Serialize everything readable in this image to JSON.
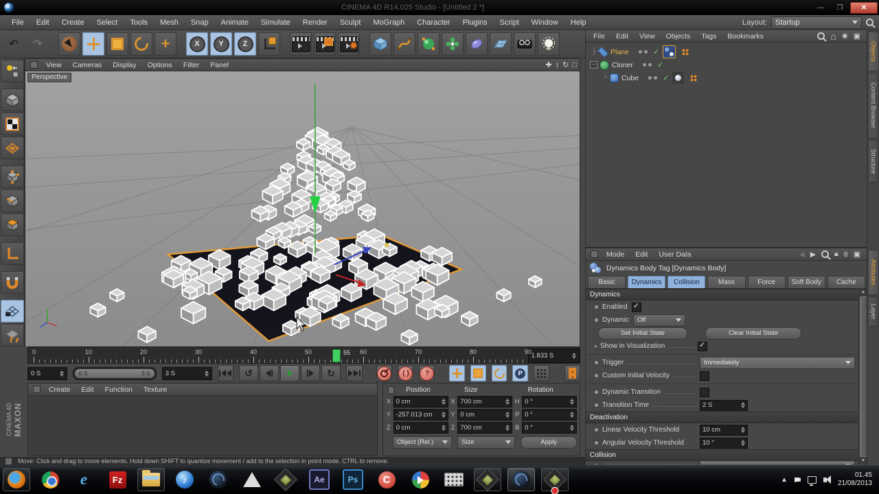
{
  "window": {
    "title": "CINEMA 4D R14.025 Studio - [Untitled 2 *]"
  },
  "menubar": {
    "items": [
      "File",
      "Edit",
      "Create",
      "Select",
      "Tools",
      "Mesh",
      "Snap",
      "Animate",
      "Simulate",
      "Render",
      "Sculpt",
      "MoGraph",
      "Character",
      "Plugins",
      "Script",
      "Window",
      "Help"
    ],
    "layout_label": "Layout:",
    "layout_value": "Startup"
  },
  "viewport": {
    "menu": [
      "View",
      "Cameras",
      "Display",
      "Options",
      "Filter",
      "Panel"
    ],
    "camera_label": "Perspective"
  },
  "object_manager": {
    "menu": [
      "File",
      "Edit",
      "View",
      "Objects",
      "Tags",
      "Bookmarks"
    ],
    "objects": [
      {
        "name": "Plane"
      },
      {
        "name": "Cloner"
      },
      {
        "name": "Cube"
      }
    ]
  },
  "side_tabs": {
    "top": [
      "Objects",
      "Content Browser",
      "Structure"
    ],
    "bottom": [
      "Attributes",
      "Layer"
    ]
  },
  "attributes": {
    "menu": [
      "Mode",
      "Edit",
      "User Data"
    ],
    "title": "Dynamics Body Tag [Dynamics Body]",
    "tabs": [
      "Basic",
      "Dynamics",
      "Collision",
      "Mass",
      "Force",
      "Soft Body",
      "Cache"
    ],
    "active_tabs": [
      "Dynamics",
      "Collision"
    ],
    "sections": {
      "dynamics": "Dynamics",
      "deactivation": "Deactivation",
      "collision": "Collision"
    },
    "labels": {
      "enabled": "Enabled",
      "dynamic": "Dynamic",
      "set_initial": "Set Initial State",
      "clear_initial": "Clear Initial State",
      "show_vis": "Show in Visualization",
      "trigger": "Trigger",
      "custom_velocity": "Custom Initial Velocity",
      "dynamic_transition": "Dynamic Transition",
      "transition_time": "Transition Time",
      "linear_threshold": "Linear Velocity Threshold",
      "angular_threshold": "Angular Velocity Threshold"
    },
    "values": {
      "dynamic": "Off",
      "trigger": "Immediately",
      "transition_time": "2 S",
      "linear_threshold": "10 cm",
      "angular_threshold": "10 °"
    }
  },
  "timeline": {
    "tick_labels": [
      "0",
      "10",
      "20",
      "30",
      "40",
      "50",
      "60",
      "70",
      "80",
      "90"
    ],
    "playhead_frame": "55",
    "current_time": "1.833 S",
    "start_time": "0 S",
    "end_time": "3 S",
    "range_min": "0 S",
    "range_max": "3 S"
  },
  "materials": {
    "menu": [
      "Create",
      "Edit",
      "Function",
      "Texture"
    ]
  },
  "coordinates": {
    "headers": [
      "Position",
      "Size",
      "Rotation"
    ],
    "position": {
      "x_label": "X",
      "x": "0 cm",
      "y_label": "Y",
      "y": "-257.013 cm",
      "z_label": "Z",
      "z": "0 cm"
    },
    "size": {
      "x_label": "X",
      "x": "700 cm",
      "y_label": "Y",
      "y": "0 cm",
      "z_label": "Z",
      "z": "700 cm"
    },
    "rotation": {
      "h_label": "H",
      "h": "0 °",
      "p_label": "P",
      "p": "0 °",
      "b_label": "B",
      "b": "0 °"
    },
    "mode_object": "Object (Rel.)",
    "mode_size": "Size",
    "apply_label": "Apply"
  },
  "status_bar": {
    "text": "Move: Click and drag to move elements. Hold down SHIFT to quantize movement / add to the selection in point mode, CTRL to remove."
  },
  "branding": {
    "line1": "MAXON",
    "line2": "CINEMA 4D"
  },
  "taskbar": {
    "clock_time": "01.45",
    "clock_date": "21/08/2013"
  },
  "colors": {
    "accent_orange": "#e8a33d",
    "selection_blue": "#a9c4e2",
    "playhead_green": "#43cf63",
    "record_red": "#cf5f53",
    "plane_outline": "#e09a3a"
  }
}
